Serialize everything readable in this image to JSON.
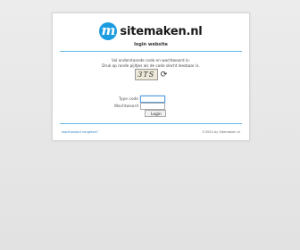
{
  "brand": {
    "mark": "m",
    "name": "sitemaken.nl",
    "color": "#1b9ce0"
  },
  "subtitle": "login website",
  "instructions": {
    "line1": "Vul onderstaande code en wachtwoord in.",
    "line2": "Druk op ronde pijltjes als de code slecht leesbaar is."
  },
  "captcha": {
    "text": "3TS"
  },
  "form": {
    "typecode_label": "Type code",
    "password_label": "Wachtwoord",
    "typecode_value": "",
    "password_value": "",
    "login_label": "Login"
  },
  "footer": {
    "forgot_link": "wachtwoord vergeten?",
    "copyright": "©2020 by Sitemaken.nl"
  }
}
